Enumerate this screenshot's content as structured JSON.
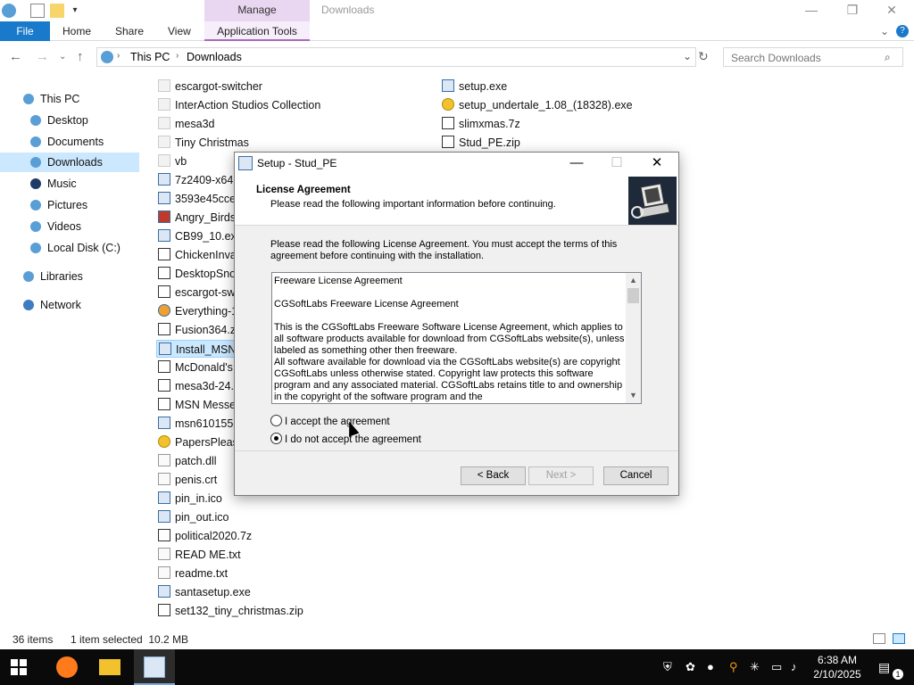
{
  "window": {
    "title": "Downloads",
    "context_group": "Manage",
    "controls": {
      "minimize": "—",
      "maximize": "❐",
      "close": "✕"
    }
  },
  "ribbon": {
    "tabs": [
      "File",
      "Home",
      "Share",
      "View",
      "Application Tools"
    ]
  },
  "address": {
    "breadcrumb": [
      "This PC",
      "Downloads"
    ],
    "search_placeholder": "Search Downloads"
  },
  "nav_pane": {
    "items": [
      {
        "label": "This PC",
        "icon": "pc-icon"
      },
      {
        "label": "Desktop",
        "icon": "desktop-icon"
      },
      {
        "label": "Documents",
        "icon": "documents-icon"
      },
      {
        "label": "Downloads",
        "icon": "downloads-icon",
        "selected": true
      },
      {
        "label": "Music",
        "icon": "music-icon"
      },
      {
        "label": "Pictures",
        "icon": "pictures-icon"
      },
      {
        "label": "Videos",
        "icon": "videos-icon"
      },
      {
        "label": "Local Disk (C:)",
        "icon": "drive-icon"
      },
      {
        "label": "Libraries",
        "icon": "libraries-icon"
      },
      {
        "label": "Network",
        "icon": "network-icon"
      }
    ]
  },
  "files": {
    "col1": [
      {
        "name": "escargot-switcher",
        "type": "folder"
      },
      {
        "name": "InterAction Studios Collection",
        "type": "folder"
      },
      {
        "name": "mesa3d",
        "type": "folder"
      },
      {
        "name": "Tiny Christmas",
        "type": "folder"
      },
      {
        "name": "vb",
        "type": "folder"
      },
      {
        "name": "7z2409-x64.e",
        "type": "exe"
      },
      {
        "name": "3593e45cceb",
        "type": "exe"
      },
      {
        "name": "Angry_Birds_",
        "type": "exe"
      },
      {
        "name": "CB99_10.exe",
        "type": "exe"
      },
      {
        "name": "ChickenInva",
        "type": "zip"
      },
      {
        "name": "DesktopSnov",
        "type": "zip"
      },
      {
        "name": "escargot-swi",
        "type": "zip"
      },
      {
        "name": "Everything-1",
        "type": "exe"
      },
      {
        "name": "Fusion364.zip",
        "type": "zip"
      },
      {
        "name": "Install_MSN_",
        "type": "exe",
        "selected": true
      },
      {
        "name": "McDonald's",
        "type": "zip"
      },
      {
        "name": "mesa3d-24.3",
        "type": "zip"
      },
      {
        "name": "MSN Messen",
        "type": "zip"
      },
      {
        "name": "msn610155-",
        "type": "exe"
      },
      {
        "name": "PapersPlease",
        "type": "cd"
      },
      {
        "name": "patch.dll",
        "type": "txt"
      },
      {
        "name": "penis.crt",
        "type": "txt"
      },
      {
        "name": "pin_in.ico",
        "type": "exe"
      },
      {
        "name": "pin_out.ico",
        "type": "exe"
      },
      {
        "name": "political2020.7z",
        "type": "zip"
      },
      {
        "name": "READ ME.txt",
        "type": "txt"
      },
      {
        "name": "readme.txt",
        "type": "txt"
      },
      {
        "name": "santasetup.exe",
        "type": "exe"
      },
      {
        "name": "set132_tiny_christmas.zip",
        "type": "zip"
      }
    ],
    "col2": [
      {
        "name": "setup.exe",
        "type": "exe"
      },
      {
        "name": "setup_undertale_1.08_(18328).exe",
        "type": "cd"
      },
      {
        "name": "slimxmas.7z",
        "type": "zip"
      },
      {
        "name": "Stud_PE.zip",
        "type": "zip"
      }
    ]
  },
  "status": {
    "count": "36 items",
    "selection": "1 item selected  10.2 MB"
  },
  "dialog": {
    "title": "Setup - Stud_PE",
    "header_title": "License Agreement",
    "header_subtitle": "Please read the following important information before continuing.",
    "intro": "Please read the following License Agreement. You must accept the terms of this agreement before continuing with the installation.",
    "license_text": "Freeware License Agreement\n\nCGSoftLabs Freeware License Agreement\n\nThis is the CGSoftLabs Freeware Software License Agreement, which applies to all software products available for download from CGSoftLabs website(s), unless labeled as something other then freeware.\nAll software available for download via the CGSoftLabs website(s) are copyright CGSoftLabs unless otherwise stated. Copyright law protects this software program and any associated material. CGSoftLabs retains title to and ownership in the copyright of the software program and the",
    "radio_accept": "I accept the agreement",
    "radio_decline": "I do not accept the agreement",
    "selected_option": "decline",
    "buttons": {
      "back": "< Back",
      "next": "Next >",
      "cancel": "Cancel"
    }
  },
  "taskbar": {
    "time": "6:38 AM",
    "date": "2/10/2025",
    "notification_count": "1"
  }
}
